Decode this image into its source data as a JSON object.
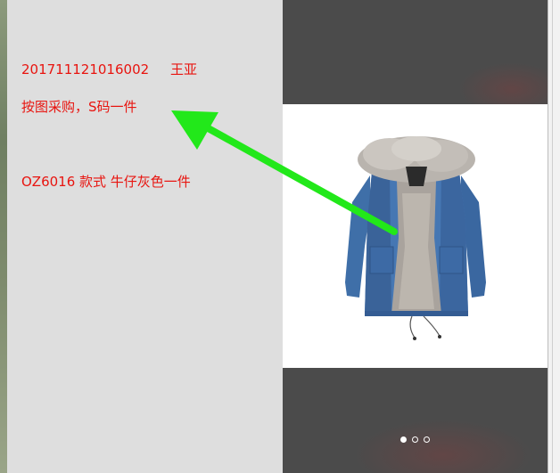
{
  "note": {
    "lines": [
      {
        "text": "201711121016002     王亚"
      },
      {
        "text": "按图采购，S码一件"
      },
      {
        "text": "OZ6016 款式 牛仔灰色一件"
      }
    ]
  },
  "carousel": {
    "page_count": 3,
    "current_page": 1,
    "image_icon": "denim-parka-fur-hood"
  },
  "colors": {
    "note_text": "#e8140f",
    "arrow": "#22e81a",
    "viewer_bg": "#4b4b4b"
  }
}
